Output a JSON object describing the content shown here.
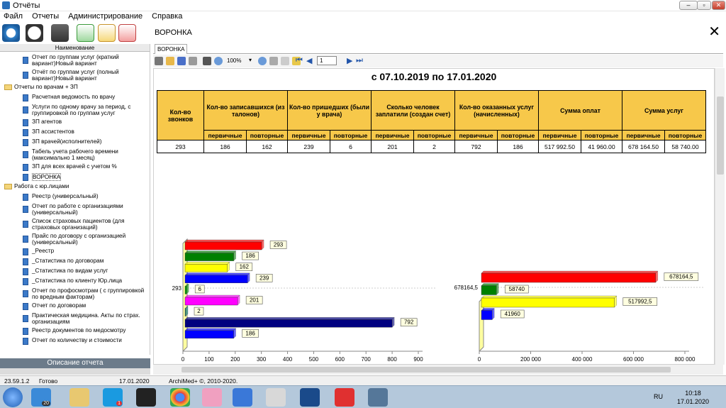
{
  "window": {
    "title": "Отчёты"
  },
  "menu": {
    "items": [
      "Файл",
      "Отчеты",
      "Администрирование",
      "Справка"
    ]
  },
  "left_panel": {
    "header": "Наименование",
    "items": [
      {
        "label1": "Отчет по группам услуг (краткий",
        "label2": "вариант)Новый вариант",
        "kind": "doc"
      },
      {
        "label1": "Отчёт по группам услуг (полный",
        "label2": "вариант)Новый вариант",
        "kind": "doc"
      },
      {
        "label1": "Отчеты по врачам + ЗП",
        "label2": "",
        "kind": "folder"
      },
      {
        "label1": "Расчетная ведомость по врачу",
        "label2": "",
        "kind": "doc"
      },
      {
        "label1": "Услуги по одному врачу за период, с",
        "label2": "группировкой по группам услуг",
        "kind": "doc"
      },
      {
        "label1": "ЗП агентов",
        "label2": "",
        "kind": "doc"
      },
      {
        "label1": "ЗП ассистентов",
        "label2": "",
        "kind": "doc"
      },
      {
        "label1": "ЗП врачей(исполнителей)",
        "label2": "",
        "kind": "doc"
      },
      {
        "label1": "Табель учета рабочего времени",
        "label2": "(максимально 1 месяц)",
        "kind": "doc"
      },
      {
        "label1": "ЗП для всех врачей с учетом %",
        "label2": "",
        "kind": "doc"
      },
      {
        "label1": "ВОРОНКА",
        "label2": "",
        "kind": "doc"
      },
      {
        "label1": "Работа с юр.лицами",
        "label2": "",
        "kind": "folder"
      },
      {
        "label1": "Реестр (универсальный)",
        "label2": "",
        "kind": "doc"
      },
      {
        "label1": "Отчет по работе с организациями",
        "label2": "(универсальный)",
        "kind": "doc"
      },
      {
        "label1": "Список страховых пациентов (для",
        "label2": "страховых организаций)",
        "kind": "doc"
      },
      {
        "label1": "Прайс по договору с организацией",
        "label2": "(универсальный)",
        "kind": "doc"
      },
      {
        "label1": "_Реестр",
        "label2": "",
        "kind": "doc"
      },
      {
        "label1": "_Статистика по договорам",
        "label2": "",
        "kind": "doc"
      },
      {
        "label1": "_Статистика по видам услуг",
        "label2": "",
        "kind": "doc"
      },
      {
        "label1": "_Статистика по клиенту Юр.лица",
        "label2": "",
        "kind": "doc"
      },
      {
        "label1": "Отчет по профосмотрам ( с группировкой",
        "label2": "по вредным факторам)",
        "kind": "doc"
      },
      {
        "label1": "Отчет по договорам",
        "label2": "",
        "kind": "doc"
      },
      {
        "label1": "Практическая медицина. Акты по страх.",
        "label2": "организациям",
        "kind": "doc"
      },
      {
        "label1": "Реестр документов по медосмотру",
        "label2": "",
        "kind": "doc"
      },
      {
        "label1": "Отчет по количеству и стоимости",
        "label2": "",
        "kind": "doc"
      }
    ],
    "description_title": "Описание отчета"
  },
  "report": {
    "header_title": "ВОРОНКА",
    "tab": "ВОРОНКА",
    "zoom": "100%",
    "page": "1",
    "title": "с 07.10.2019 по 17.01.2020",
    "columns": [
      "Кол-во звонков",
      "Кол-во записавшихся (из талонов)",
      "Кол-во пришедших (были у врача)",
      "Сколько человек заплатили (создан счет)",
      "Кол-во оказанных услуг (начисленных)",
      "Сумма оплат",
      "Сумма услуг"
    ],
    "sub_primary": "первичные",
    "sub_repeat": "повторные",
    "row": [
      "293",
      "186",
      "162",
      "239",
      "6",
      "201",
      "2",
      "792",
      "186",
      "517 992.50",
      "41 960.00",
      "678 164.50",
      "58 740.00"
    ]
  },
  "chart_data": [
    {
      "type": "bar",
      "orientation": "horizontal",
      "categories": [
        "Кол-во звонков",
        "записавшихся первичные",
        "записавшихся повторные",
        "пришедших первичные",
        "пришедших повторные",
        "заплатили первичные",
        "заплатили повторные",
        "услуг первичные",
        "услуг повторные"
      ],
      "values": [
        293,
        186,
        162,
        239,
        6,
        201,
        2,
        792,
        186
      ],
      "colors": [
        "#ff0000",
        "#008000",
        "#ffff00",
        "#0000ff",
        "#00a000",
        "#ff00ff",
        "#008080",
        "#000080",
        "#0000ff"
      ],
      "y_marker": "293",
      "xlim": [
        0,
        900
      ],
      "xticks": [
        "0",
        "100",
        "200",
        "300",
        "400",
        "500",
        "600",
        "700",
        "800",
        "900"
      ]
    },
    {
      "type": "bar",
      "orientation": "horizontal",
      "categories": [
        "Сумма услуг первичные",
        "Сумма услуг повторные",
        "Сумма оплат первичные",
        "Сумма оплат повторные"
      ],
      "values": [
        678164.5,
        58740,
        517992.5,
        41960
      ],
      "labels": [
        "678164,5",
        "58740",
        "517992,5",
        "41960"
      ],
      "colors": [
        "#ff0000",
        "#008000",
        "#ffff00",
        "#0000ff"
      ],
      "y_marker": "678164,5",
      "xlim": [
        0,
        800000
      ],
      "xticks": [
        "0",
        "200 000",
        "400 000",
        "600 000",
        "800 000"
      ]
    }
  ],
  "status": {
    "version": "23.59.1.2",
    "state": "Готово",
    "date": "17.01.2020",
    "copyright": "ArchiMed+ ©, 2010-2020."
  },
  "taskbar": {
    "lang": "RU",
    "time": "10:18",
    "date": "17.01.2020",
    "badge1": "20",
    "badge2": "1"
  }
}
